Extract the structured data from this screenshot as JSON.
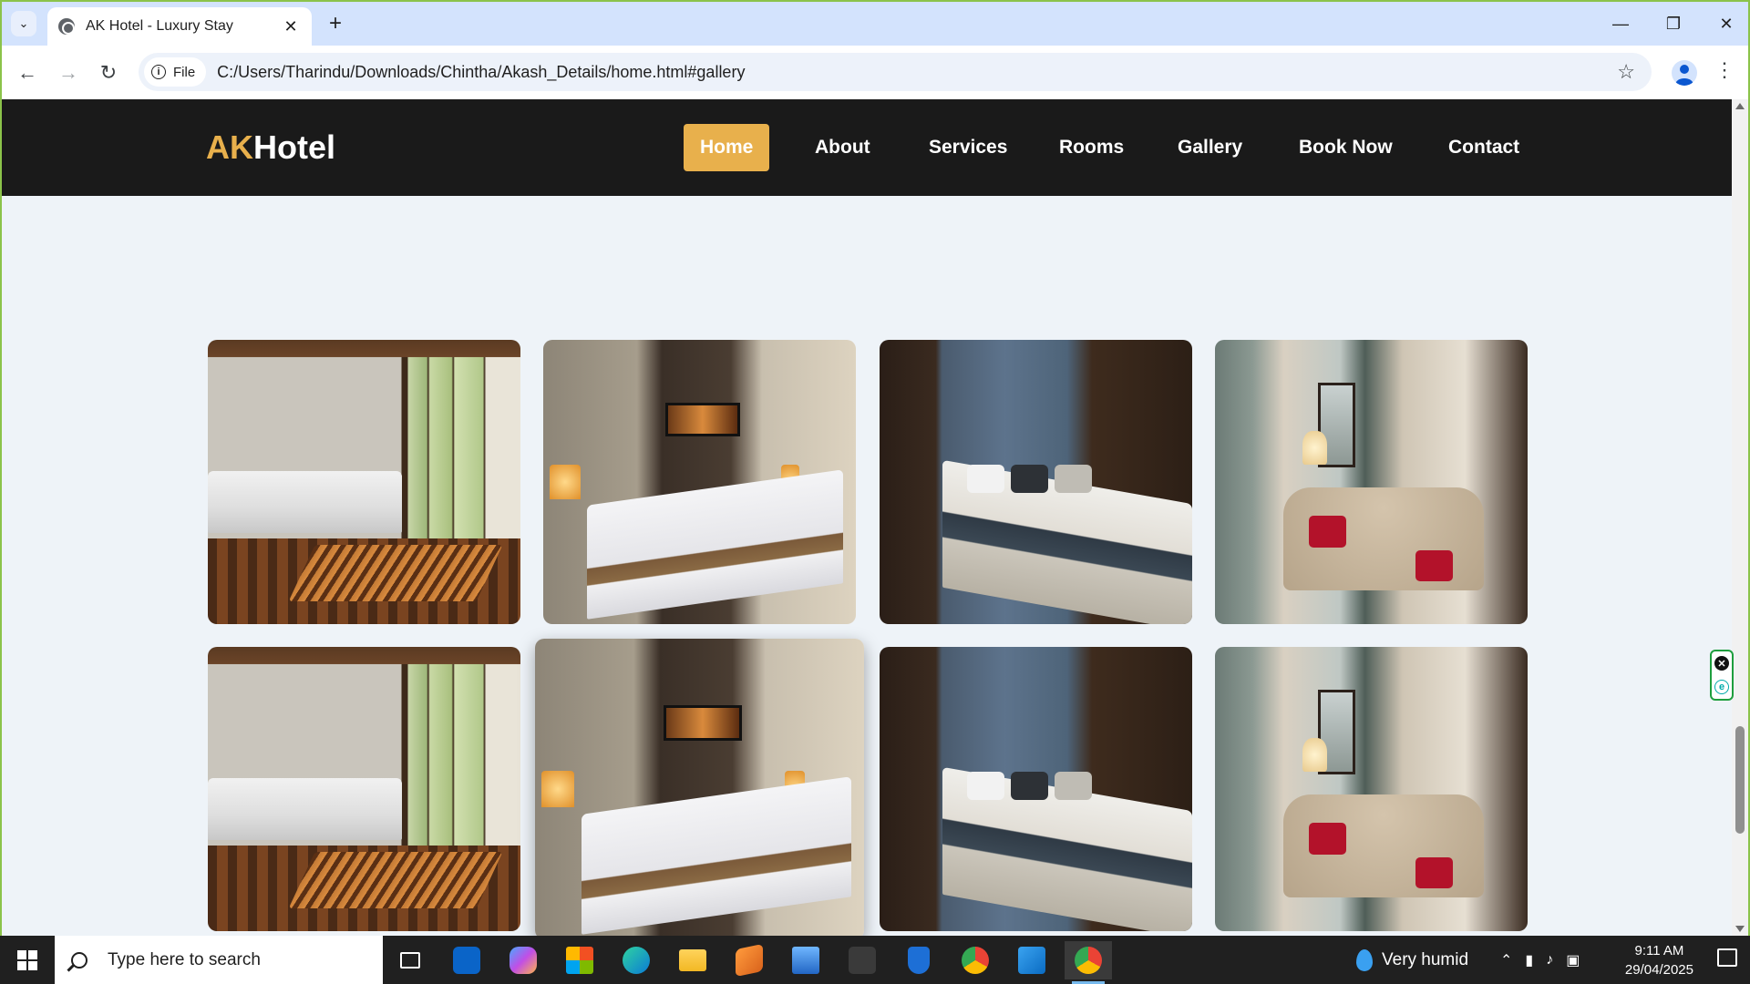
{
  "browser": {
    "tab_title": "AK Hotel - Luxury Stay",
    "address_chip": "File",
    "url": "C:/Users/Tharindu/Downloads/Chintha/Akash_Details/home.html#gallery"
  },
  "site": {
    "logo_accent": "AK",
    "logo_rest": "Hotel",
    "accent_color": "#e8b04c",
    "nav": [
      {
        "label": "Home",
        "active": true
      },
      {
        "label": "About"
      },
      {
        "label": "Services"
      },
      {
        "label": "Rooms"
      },
      {
        "label": "Gallery"
      },
      {
        "label": "Book Now"
      },
      {
        "label": "Contact"
      }
    ]
  },
  "gallery": {
    "photos": [
      {
        "scene": "bedroom-with-bench-and-windows"
      },
      {
        "scene": "bedroom-with-tv-and-lamps"
      },
      {
        "scene": "bedroom-with-blue-headboard"
      },
      {
        "scene": "suite-with-sofa-and-red-pillows"
      },
      {
        "scene": "bedroom-with-bench-and-windows"
      },
      {
        "scene": "bedroom-with-tv-and-lamps",
        "hovered": true
      },
      {
        "scene": "bedroom-with-blue-headboard"
      },
      {
        "scene": "suite-with-sofa-and-red-pillows"
      }
    ]
  },
  "taskbar": {
    "search_placeholder": "Type here to search",
    "weather": "Very humid",
    "time": "9:11 AM",
    "date": "29/04/2025",
    "apps": [
      "task-view",
      "outlook",
      "copilot",
      "microsoft-store",
      "edge",
      "file-explorer",
      "sublime-text",
      "remote-desktop",
      "obs",
      "defender",
      "chrome",
      "vscode",
      "chrome-active"
    ]
  }
}
